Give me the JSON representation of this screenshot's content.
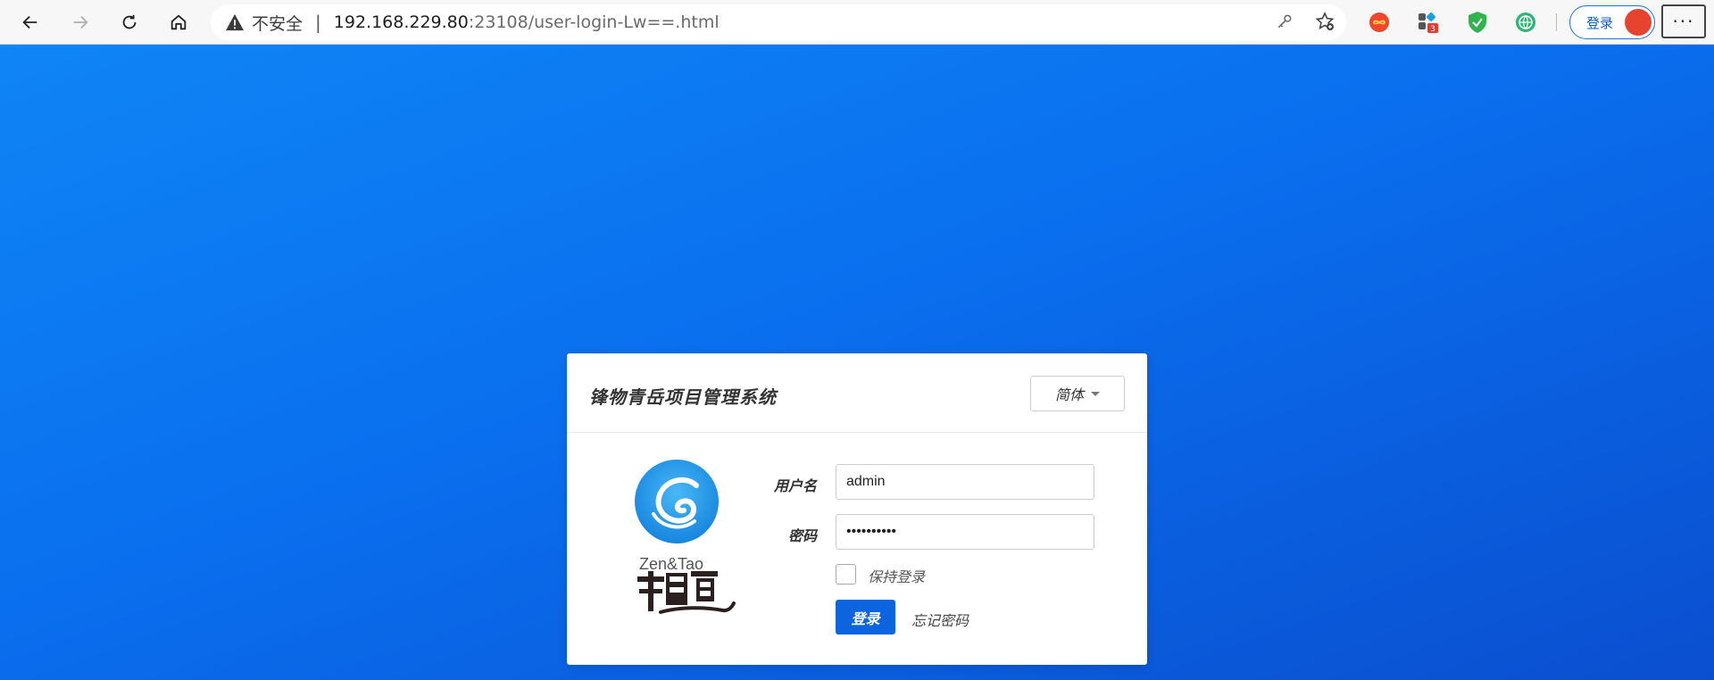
{
  "browser": {
    "insecure_label": "不安全",
    "separator": "|",
    "url_host": "192.168.229.80",
    "url_path": ":23108/user-login-Lw==.html",
    "signin_label": "登录",
    "extension_badge": "3",
    "more_label": "···"
  },
  "login": {
    "title": "锋物青岳项目管理系统",
    "language": "简体",
    "logo_text": "Zen&Tao",
    "username_label": "用户名",
    "username_value": "admin",
    "password_label": "密码",
    "password_value": "••••••••••",
    "remember_label": "保持登录",
    "submit_label": "登录",
    "forgot_label": "忘记密码"
  },
  "colors": {
    "accent": "#0c64de",
    "background_start": "#0f85f6",
    "background_end": "#0a4fd0"
  }
}
